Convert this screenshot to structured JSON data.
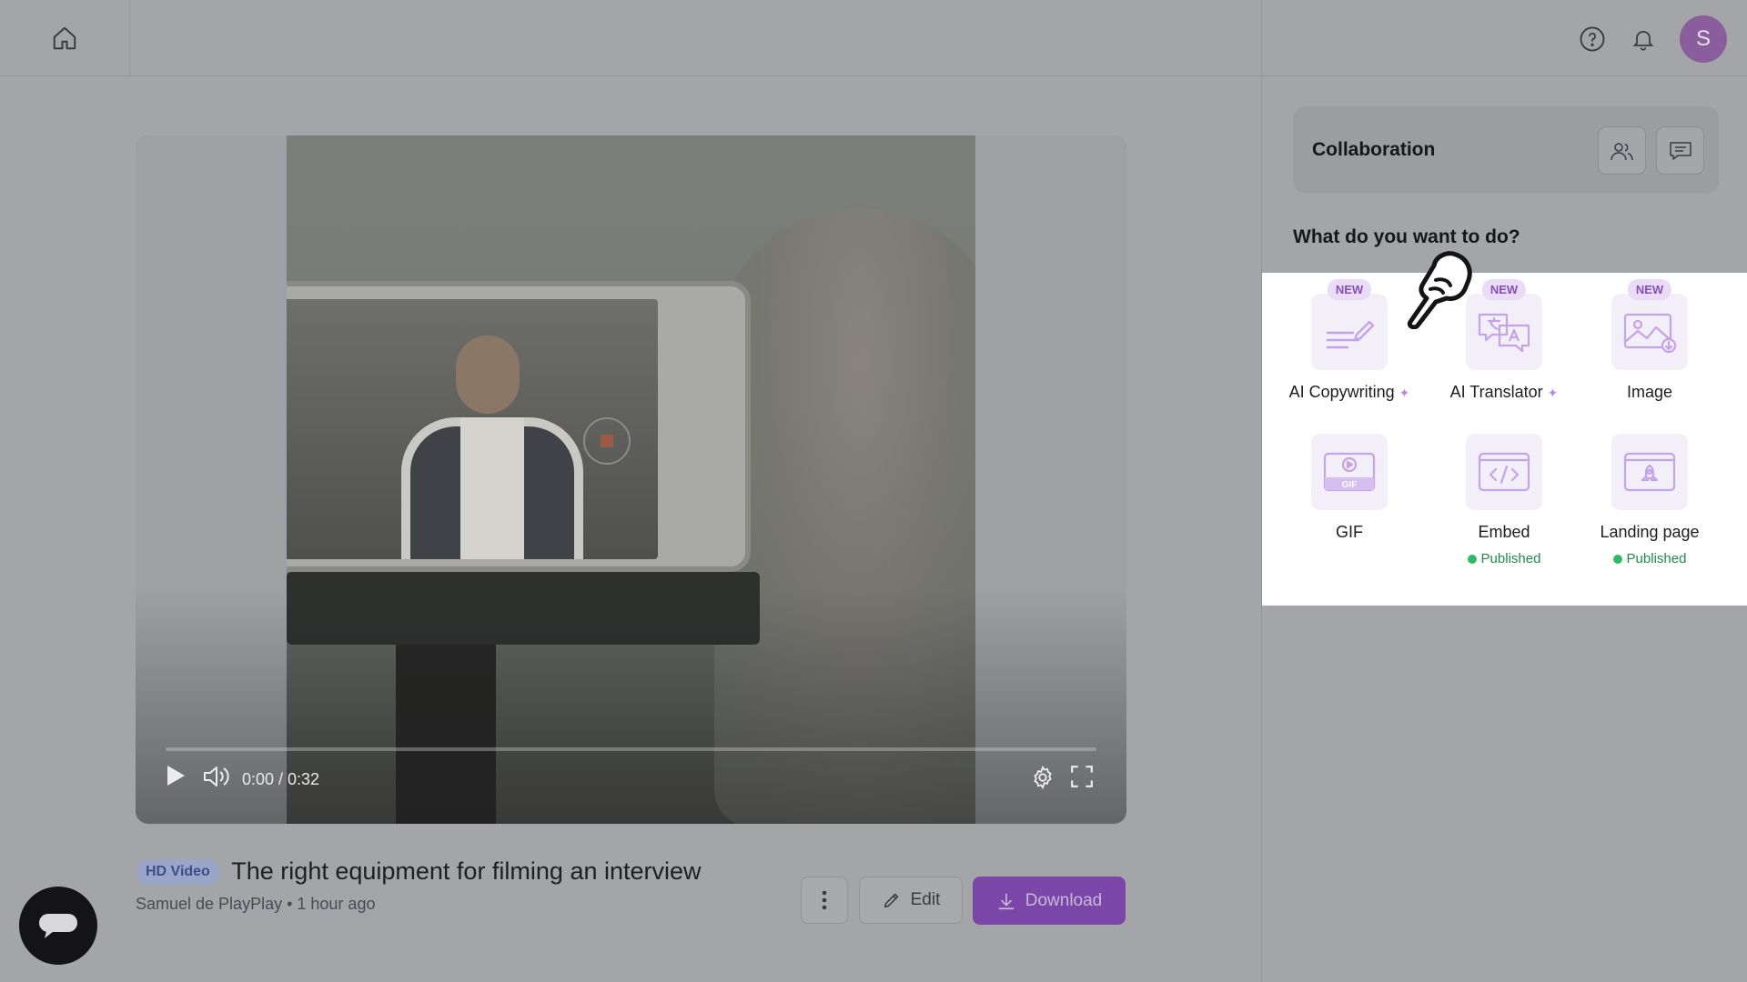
{
  "video": {
    "time": "0:00 / 0:32",
    "badge": "HD Video",
    "title": "The right equipment for filming an interview",
    "author_line": "Samuel de PlayPlay • 1 hour ago",
    "progress_fraction": 0
  },
  "actions": {
    "edit_label": "Edit",
    "download_label": "Download"
  },
  "user": {
    "avatar_initial": "S"
  },
  "panel": {
    "collaboration_title": "Collaboration",
    "question": "What do you want to do?",
    "tools": [
      {
        "label": "AI Copywriting",
        "badge": "NEW",
        "sparkle": true,
        "icon": "ai-copywriting-icon"
      },
      {
        "label": "AI Translator",
        "badge": "NEW",
        "sparkle": true,
        "icon": "ai-translator-icon"
      },
      {
        "label": "Image",
        "badge": "NEW",
        "icon": "image-icon"
      },
      {
        "label": "GIF",
        "icon": "gif-icon"
      },
      {
        "label": "Embed",
        "status": "Published",
        "icon": "embed-icon"
      },
      {
        "label": "Landing page",
        "status": "Published",
        "icon": "landing-page-icon"
      }
    ]
  },
  "colors": {
    "accent": "#7a46a8",
    "published_green": "#2fb865",
    "new_badge_bg": "#eadcf6",
    "overlay_bg": "#a4a5a9"
  }
}
